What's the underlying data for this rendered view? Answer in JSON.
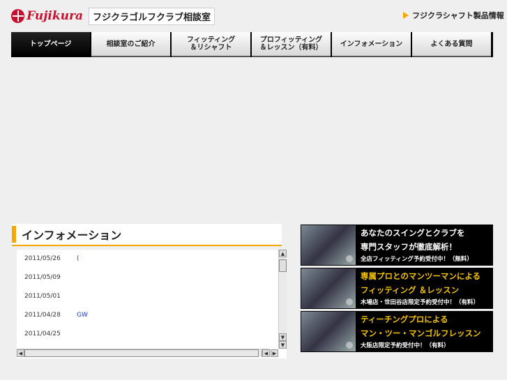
{
  "header": {
    "logo_text": "Fujikura",
    "site_title": "フジクラゴルフクラブ相談室",
    "product_link": "フジクラシャフト製品情報"
  },
  "nav": {
    "tabs": [
      {
        "line1": "トップページ",
        "line2": ""
      },
      {
        "line1": "相談室のご紹介",
        "line2": ""
      },
      {
        "line1": "フィッティング",
        "line2": "＆リシャフト"
      },
      {
        "line1": "プロフィッティング",
        "line2": "＆レッスン（有料）"
      },
      {
        "line1": "インフォメーション",
        "line2": ""
      },
      {
        "line1": "よくある質問",
        "line2": ""
      }
    ]
  },
  "info": {
    "title": "インフォメーション",
    "items": [
      {
        "date": "2011/05/26",
        "text": "("
      },
      {
        "date": "2011/05/09",
        "text": ""
      },
      {
        "date": "2011/05/01",
        "text": ""
      },
      {
        "date": "2011/04/28",
        "text": "GW"
      },
      {
        "date": "2011/04/25",
        "text": ""
      }
    ]
  },
  "banners": [
    {
      "line1": "あなたのスイングとクラブを",
      "line2": "専門スタッフが徹底解析！",
      "sub": "全店フィッティング予約受付中！（無料）",
      "accent": "#ffffff"
    },
    {
      "line1": "専属プロとのマンツーマンによる",
      "line2": "フィッティング ＆レッスン",
      "sub": "木場店・世田谷店限定予約受付中！（有料）",
      "accent": "#f5c400"
    },
    {
      "line1": "ティーチングプロによる",
      "line2": "マン・ツー・マンゴルフレッスン",
      "sub": "大阪店限定予約受付中！（有料）",
      "accent": "#f5c400"
    }
  ],
  "colors": {
    "brand_red": "#c8102e",
    "accent_yellow": "#f5a800",
    "link_blue": "#1a3fb8"
  }
}
